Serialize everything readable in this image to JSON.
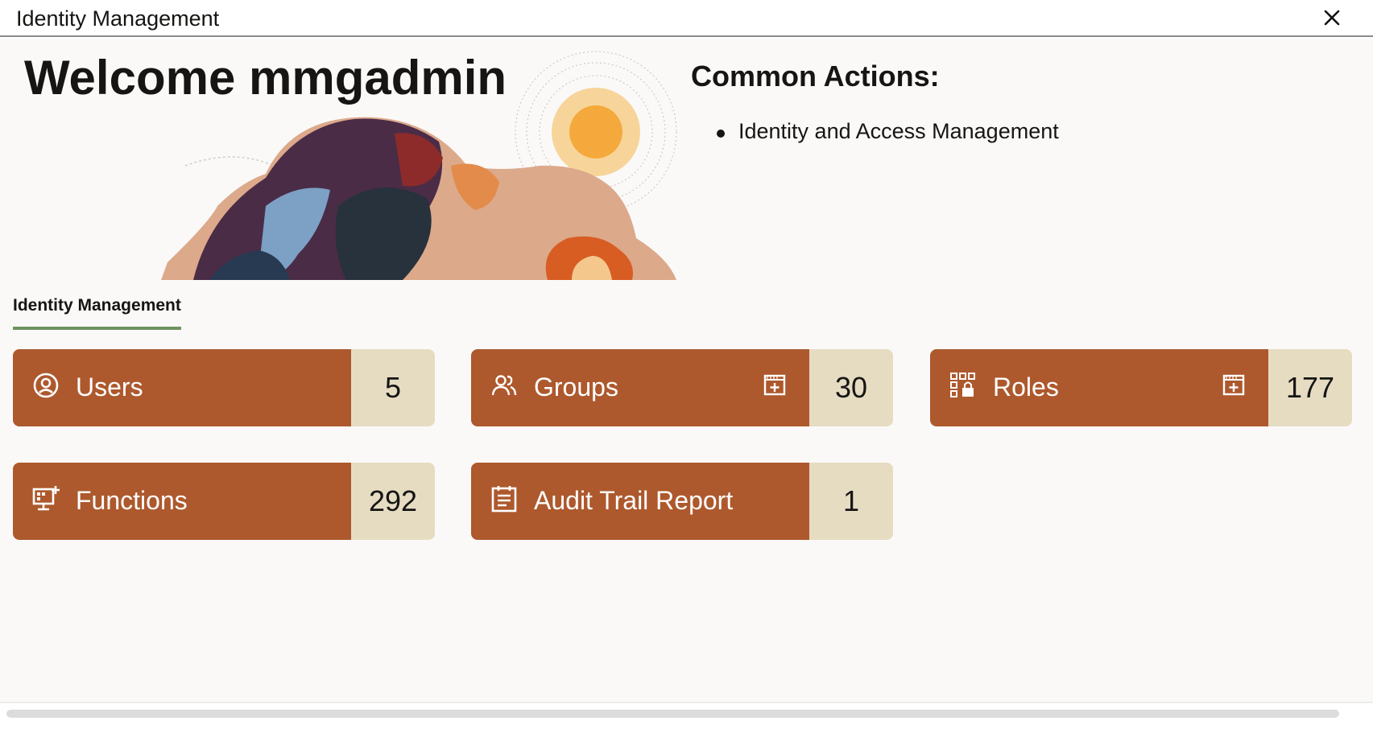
{
  "window": {
    "title": "Identity Management",
    "close_icon": "close-icon"
  },
  "header": {
    "welcome": "Welcome mmgadmin"
  },
  "common_actions": {
    "heading": "Common Actions:",
    "items": [
      {
        "label": "Identity and Access Management"
      }
    ]
  },
  "tabs": [
    {
      "label": "Identity Management",
      "selected": true
    }
  ],
  "tiles": [
    {
      "label": "Users",
      "count": "5",
      "icon": "user-circle-icon",
      "has_add": false
    },
    {
      "label": "Groups",
      "count": "30",
      "icon": "group-icon",
      "has_add": true
    },
    {
      "label": "Roles",
      "count": "177",
      "icon": "roles-icon",
      "has_add": true
    },
    {
      "label": "Functions",
      "count": "292",
      "icon": "functions-icon",
      "has_add": false
    },
    {
      "label": "Audit Trail Report",
      "count": "1",
      "icon": "clipboard-icon",
      "has_add": false
    }
  ],
  "colors": {
    "tile_main": "#ad592d",
    "tile_count": "#e6dcc2",
    "tab_underline": "#6f9461",
    "page_bg": "#fbf9f8"
  }
}
